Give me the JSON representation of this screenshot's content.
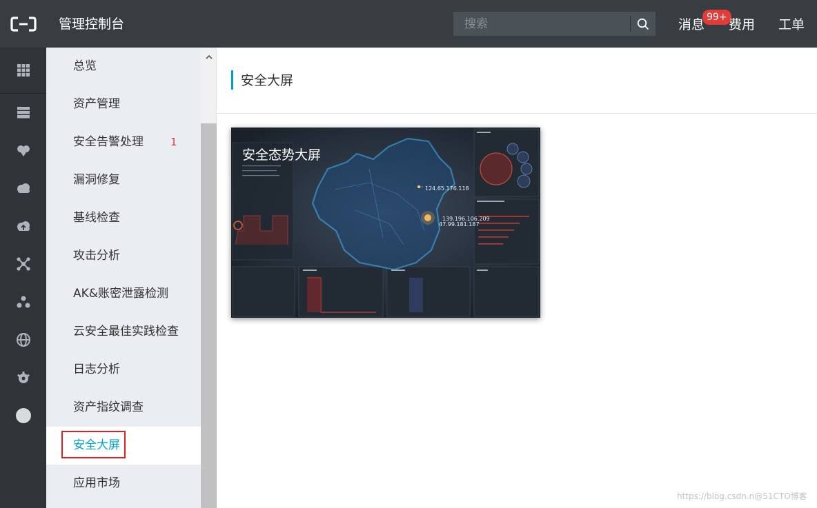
{
  "header": {
    "console_title": "管理控制台",
    "search_placeholder": "搜索",
    "messages_label": "消息",
    "messages_badge": "99+",
    "billing_label": "费用",
    "ticket_label": "工单"
  },
  "iconbar": {
    "icons": [
      "grid-icon",
      "server-icon",
      "security-shield-icon",
      "cloud-icon",
      "cloud-upload-icon",
      "network-icon",
      "cluster-icon",
      "globe-icon",
      "settings-gear-icon",
      "circle-icon"
    ]
  },
  "sidebar": {
    "items": [
      {
        "label": "总览"
      },
      {
        "label": "资产管理"
      },
      {
        "label": "安全告警处理",
        "count": "1"
      },
      {
        "label": "漏洞修复"
      },
      {
        "label": "基线检查"
      },
      {
        "label": "攻击分析"
      },
      {
        "label": "AK&账密泄露检测"
      },
      {
        "label": "云安全最佳实践检查"
      },
      {
        "label": "日志分析"
      },
      {
        "label": "资产指纹调查"
      },
      {
        "label": "安全大屏",
        "active": true
      },
      {
        "label": "应用市场"
      }
    ]
  },
  "main": {
    "page_title": "安全大屏",
    "card": {
      "title": "安全态势大屏",
      "ip_1": "124.65.176.118",
      "ip_2": "139.196.106.209",
      "ip_3": "47.99.181.187"
    }
  },
  "watermark": "https://blog.csdn.n@51CTO博客",
  "colors": {
    "topbar": "#373d41",
    "iconbar": "#2f3438",
    "sidebar": "#eaedf1",
    "accent": "#00a2ca",
    "badge": "#e23c39",
    "highlight_box": "#e02020"
  }
}
